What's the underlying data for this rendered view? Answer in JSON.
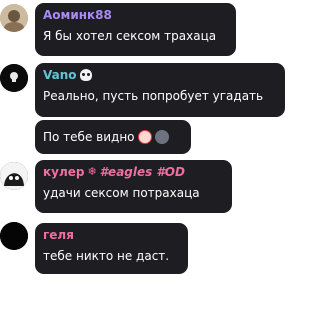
{
  "messages": [
    {
      "author": "Аоминк88",
      "text": "Я бы хотел сексом трахаца"
    },
    {
      "author": "Vano",
      "text": "Реально, пусть попробует угадать"
    },
    {
      "author": "",
      "text": "По тебе видно"
    },
    {
      "author_main": "кулер",
      "author_mark": "❄",
      "author_tag": "#eagles #OD",
      "text": "удачи сексом потрахаца"
    },
    {
      "author": "геля",
      "text": "тебе никто не даст."
    }
  ],
  "colors": {
    "bubble": "#1e1d22",
    "name_violet": "#a88cf2",
    "name_teal": "#61c5d6",
    "name_pink": "#ee6fa1"
  }
}
